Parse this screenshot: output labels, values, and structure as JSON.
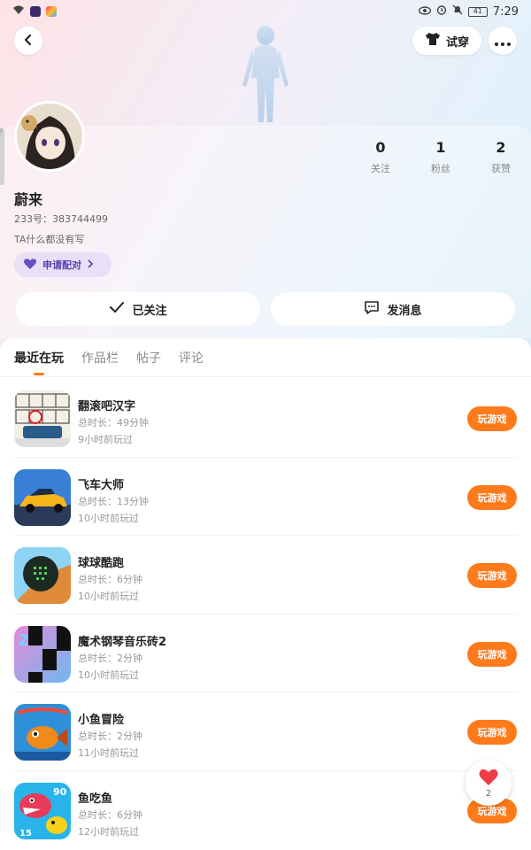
{
  "statusbar": {
    "time": "7:29",
    "battery": "41"
  },
  "header": {
    "tryon_label": "试穿"
  },
  "profile": {
    "name": "蔚来",
    "uid": "233号：383744499",
    "bio": "TA什么都没有写",
    "pair_label": "申请配对",
    "stats": [
      {
        "value": "0",
        "label": "关注"
      },
      {
        "value": "1",
        "label": "粉丝"
      },
      {
        "value": "2",
        "label": "获赞"
      }
    ],
    "follow_label": "已关注",
    "message_label": "发消息"
  },
  "tabs": [
    "最近在玩",
    "作品栏",
    "帖子",
    "评论"
  ],
  "games": [
    {
      "title": "翻滚吧汉字",
      "duration": "总时长：49分钟",
      "last_played": "9小时前玩过",
      "icon": "hanzi-game-icon"
    },
    {
      "title": "飞车大师",
      "duration": "总时长：13分钟",
      "last_played": "10小时前玩过",
      "icon": "racing-car-icon"
    },
    {
      "title": "球球酷跑",
      "duration": "总时长：6分钟",
      "last_played": "10小时前玩过",
      "icon": "ball-run-icon"
    },
    {
      "title": "魔术钢琴音乐砖2",
      "duration": "总时长：2分钟",
      "last_played": "10小时前玩过",
      "icon": "piano-tiles-icon"
    },
    {
      "title": "小鱼冒险",
      "duration": "总时长：2分钟",
      "last_played": "11小时前玩过",
      "icon": "fish-adventure-icon"
    },
    {
      "title": "鱼吃鱼",
      "duration": "总时长：6分钟",
      "last_played": "12小时前玩过",
      "icon": "fish-eat-fish-icon"
    }
  ],
  "play_label": "玩游戏",
  "like_count": "2",
  "colors": {
    "accent": "#ff7a1a",
    "pair_bg": "#e7e0f6",
    "pair_text": "#5b3fb0"
  }
}
